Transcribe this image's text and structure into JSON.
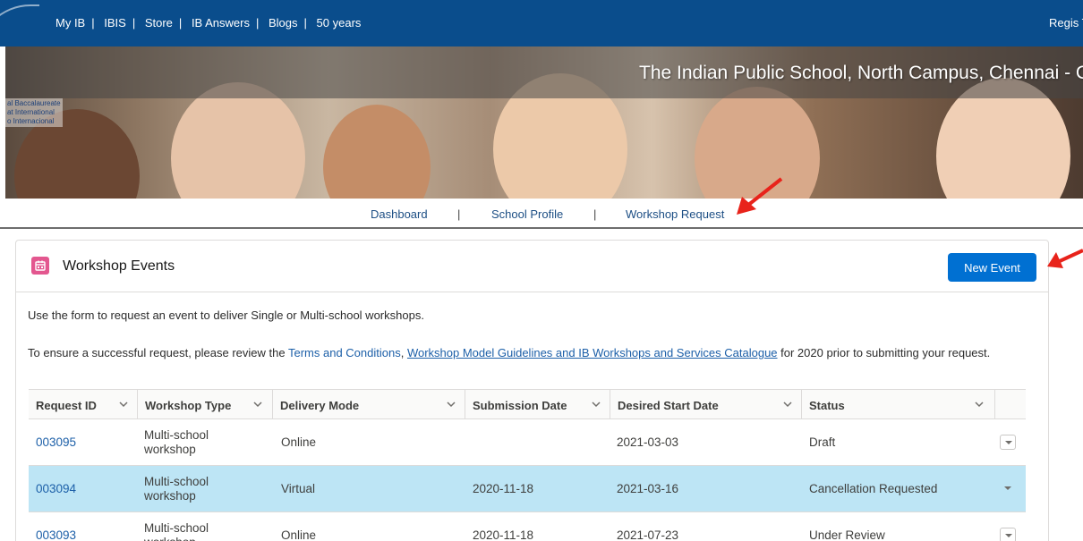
{
  "top_nav": {
    "links": [
      "My IB",
      "IBIS",
      "Store",
      "IB Answers",
      "Blogs",
      "50 years"
    ],
    "right_text": "Regis To"
  },
  "banner": {
    "logo_lines": [
      "al Baccalaureate",
      "at International",
      "o Internacional"
    ],
    "school_name": "The Indian Public School, North Campus, Chennai - C"
  },
  "sub_nav": {
    "dashboard": "Dashboard",
    "school_profile": "School Profile",
    "workshop_request": "Workshop Request",
    "separator": "|"
  },
  "card": {
    "title": "Workshop Events",
    "new_event_label": "New Event",
    "intro": "Use the form to request an event to deliver Single or Multi-school workshops.",
    "terms_prefix": "To ensure a successful request, please review the ",
    "terms_link1": "Terms and Conditions",
    "terms_comma": ", ",
    "terms_link2": "Workshop Model Guidelines and IB Workshops and Services Catalogue",
    "terms_suffix": " for 2020 prior to submitting your request."
  },
  "table": {
    "columns": [
      "Request ID",
      "Workshop Type",
      "Delivery Mode",
      "Submission Date",
      "Desired Start Date",
      "Status"
    ],
    "rows": [
      {
        "id": "003095",
        "type": "Multi-school workshop",
        "mode": "Online",
        "submitted": "",
        "start": "2021-03-03",
        "status": "Draft"
      },
      {
        "id": "003094",
        "type": "Multi-school workshop",
        "mode": "Virtual",
        "submitted": "2020-11-18",
        "start": "2021-03-16",
        "status": "Cancellation Requested"
      },
      {
        "id": "003093",
        "type": "Multi-school workshop",
        "mode": "Online",
        "submitted": "2020-11-18",
        "start": "2021-07-23",
        "status": "Under Review"
      }
    ]
  },
  "colors": {
    "top_bar": "#0a4d8c",
    "primary_button": "#0070d2",
    "selected_row": "#bde5f5",
    "link": "#1c5fa8",
    "calendar_icon": "#e3578f",
    "annotation_arrow": "#e8231b"
  },
  "icons": [
    "calendar-icon",
    "chevron-down-icon",
    "row-menu-icon",
    "annotation-arrow"
  ]
}
